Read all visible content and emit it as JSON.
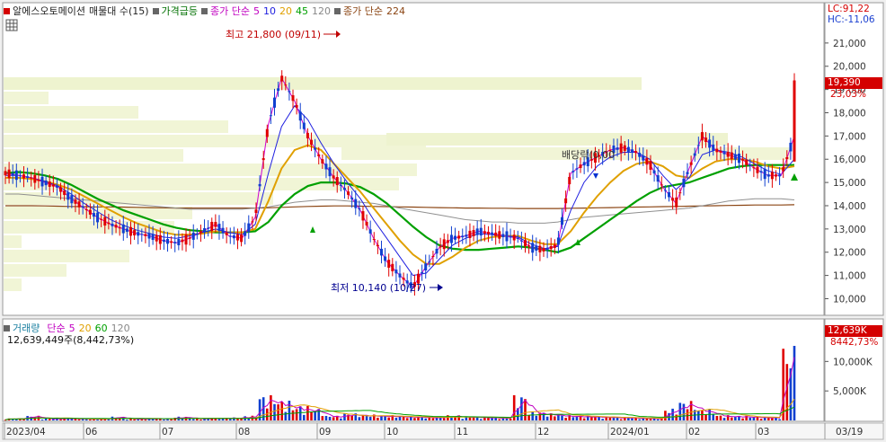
{
  "price_panel": {
    "legend": {
      "series_name": "알에스오토메이션",
      "indicator": "매물대 수(15)",
      "price_surge": "가격급등",
      "ma_prefix": "종가 단순",
      "ma_periods": [
        "5",
        "10",
        "20",
        "45",
        "120"
      ],
      "ma_long_prefix": "종가 단순",
      "ma_long_period": "224",
      "colors": {
        "p5": "#d000d0",
        "p10": "#2020e0",
        "p20": "#e0a000",
        "p45": "#00a000",
        "p120": "#909090",
        "p224": "#8b4513"
      }
    },
    "high_annotation": "최고 21,800 (09/11)",
    "low_annotation": "최저 10,140 (10/27)",
    "dividend_annotation": "배당락(0,00",
    "lc": "LC:91,22",
    "hc": "HC:-11,06",
    "price_tag": "19,390",
    "change_tag": "23,03%",
    "y_ticks": [
      "21,000",
      "20,000",
      "19,000",
      "18,000",
      "17,000",
      "16,000",
      "15,000",
      "14,000",
      "13,000",
      "12,000",
      "11,000",
      "10,000"
    ]
  },
  "volume_panel": {
    "legend": {
      "label": "거래량",
      "ma_prefix": "단순",
      "periods": [
        "5",
        "20",
        "60",
        "120"
      ]
    },
    "readout": "12,639,449주(8,442,73%)",
    "volume_tag": "12,639K",
    "percent_tag": "8442,73%",
    "y_ticks": [
      "10,000K",
      "5,000K"
    ]
  },
  "x_axis": {
    "labels": [
      "2023/04",
      "06",
      "07",
      "08",
      "09",
      "10",
      "11",
      "12",
      "2024/01",
      "02",
      "03"
    ],
    "right_date": "03/19"
  },
  "chart_data": {
    "type": "line",
    "title": "알에스오토메이션",
    "x_range": [
      "2023/04",
      "2024/03/19"
    ],
    "price_ylim": [
      9400,
      22000
    ],
    "volume_ylim": [
      0,
      12639
    ],
    "series": [
      {
        "name": "5",
        "values": [
          15400,
          15300,
          15200,
          15000,
          14800,
          14300,
          13900,
          13500,
          13200,
          13000,
          12800,
          12700,
          12500,
          12400,
          12600,
          12900,
          13200,
          12700,
          12600,
          13500,
          17500,
          19500,
          18500,
          17000,
          16000,
          15200,
          14600,
          13800,
          12600,
          11600,
          11000,
          10500,
          11400,
          12200,
          12600,
          12700,
          12900,
          12800,
          12700,
          12600,
          12200,
          12100,
          12300,
          15400,
          15800,
          16100,
          16400,
          16500,
          16300,
          15800,
          14800,
          14100,
          15600,
          17000,
          16400,
          16200,
          16000,
          15600,
          15300,
          15300,
          17000
        ]
      },
      {
        "name": "10",
        "values": [
          15300,
          15300,
          15200,
          15050,
          14850,
          14500,
          14100,
          13750,
          13400,
          13150,
          12950,
          12800,
          12650,
          12600,
          12700,
          12850,
          13000,
          12850,
          12750,
          13200,
          15400,
          17400,
          18300,
          17700,
          16700,
          15800,
          15000,
          14300,
          13400,
          12600,
          11800,
          11000,
          11100,
          11700,
          12300,
          12600,
          12800,
          12750,
          12700,
          12650,
          12350,
          12150,
          12250,
          13800,
          15000,
          15700,
          16100,
          16300,
          16300,
          16000,
          15300,
          14700,
          15200,
          16200,
          16400,
          16300,
          16100,
          15800,
          15500,
          15350,
          16000
        ]
      },
      {
        "name": "20",
        "values": [
          15200,
          15200,
          15150,
          15050,
          14900,
          14700,
          14400,
          14100,
          13800,
          13500,
          13250,
          13050,
          12850,
          12750,
          12750,
          12800,
          12900,
          12850,
          12850,
          13000,
          14200,
          15600,
          16400,
          16600,
          16400,
          15800,
          15200,
          14600,
          13900,
          13200,
          12500,
          11900,
          11500,
          11500,
          11800,
          12200,
          12500,
          12650,
          12700,
          12700,
          12500,
          12350,
          12350,
          12900,
          13700,
          14400,
          15000,
          15500,
          15800,
          15900,
          15700,
          15300,
          15200,
          15600,
          15900,
          16000,
          16000,
          15900,
          15700,
          15600,
          15700
        ]
      },
      {
        "name": "45",
        "values": [
          15400,
          15450,
          15400,
          15300,
          15150,
          14900,
          14600,
          14300,
          14050,
          13800,
          13600,
          13400,
          13200,
          13050,
          12950,
          12900,
          12850,
          12850,
          12850,
          12900,
          13300,
          14000,
          14500,
          14850,
          15000,
          15000,
          14950,
          14800,
          14500,
          14100,
          13600,
          13100,
          12650,
          12300,
          12150,
          12100,
          12100,
          12150,
          12200,
          12250,
          12200,
          12100,
          12000,
          12200,
          12600,
          13000,
          13400,
          13800,
          14200,
          14550,
          14800,
          14900,
          15000,
          15200,
          15400,
          15600,
          15700,
          15750,
          15750,
          15750,
          15750
        ]
      },
      {
        "name": "120",
        "values": [
          14500,
          14500,
          14450,
          14400,
          14350,
          14300,
          14250,
          14200,
          14150,
          14100,
          14050,
          14000,
          13950,
          13900,
          13850,
          13850,
          13850,
          13850,
          13850,
          13900,
          13950,
          14050,
          14150,
          14200,
          14250,
          14250,
          14200,
          14150,
          14100,
          14000,
          13900,
          13800,
          13700,
          13600,
          13500,
          13400,
          13350,
          13300,
          13300,
          13250,
          13250,
          13250,
          13300,
          13400,
          13500,
          13550,
          13600,
          13650,
          13700,
          13750,
          13800,
          13850,
          13900,
          14000,
          14100,
          14200,
          14250,
          14300,
          14300,
          14300,
          14250
        ]
      },
      {
        "name": "224",
        "values": [
          14000,
          14000,
          14000,
          13990,
          13980,
          13970,
          13960,
          13950,
          13950,
          13940,
          13930,
          13920,
          13910,
          13900,
          13900,
          13900,
          13900,
          13900,
          13900,
          13900,
          13910,
          13930,
          13950,
          13970,
          13980,
          13990,
          13990,
          13980,
          13970,
          13960,
          13950,
          13940,
          13930,
          13920,
          13910,
          13900,
          13900,
          13890,
          13890,
          13880,
          13880,
          13880,
          13880,
          13890,
          13900,
          13910,
          13920,
          13930,
          13940,
          13950,
          13960,
          13970,
          13980,
          13990,
          14000,
          14010,
          14020,
          14030,
          14030,
          14030,
          14040
        ]
      }
    ],
    "volume_spikes": [
      350,
      800,
      350,
      400,
      350,
      300,
      650,
      300,
      350,
      400,
      650,
      350,
      450,
      500,
      800,
      4300,
      3400,
      2500,
      2000,
      800,
      1200,
      1000,
      900,
      800,
      700,
      600,
      900,
      700,
      600,
      500,
      4300,
      1500,
      1200,
      900,
      800,
      700,
      600,
      500,
      400,
      2000,
      3300,
      1900,
      900,
      800,
      700,
      600,
      12639
    ]
  }
}
